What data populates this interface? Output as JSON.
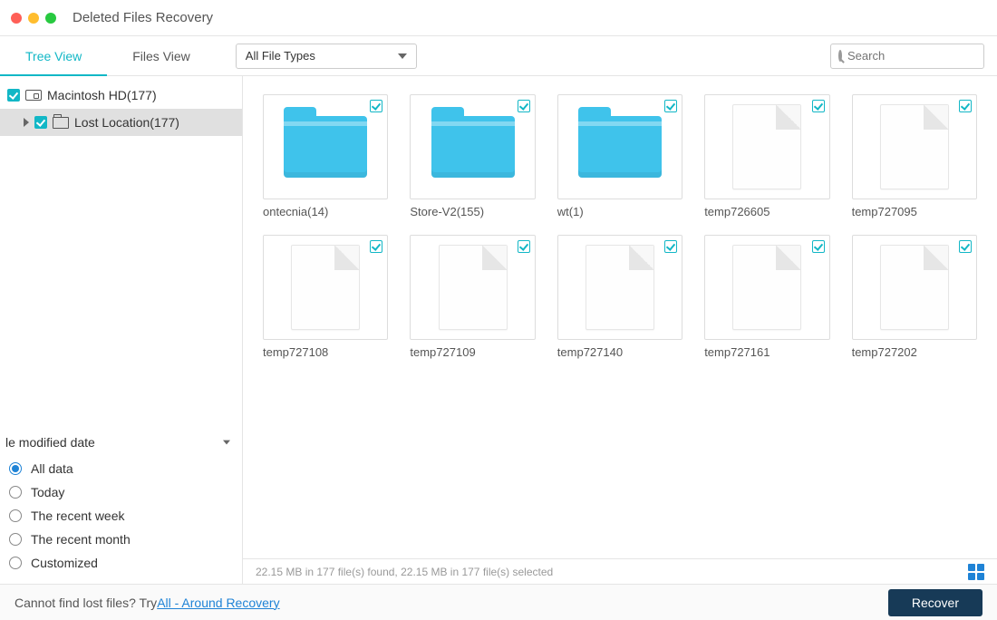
{
  "window": {
    "title": "Deleted Files Recovery"
  },
  "toolbar": {
    "tabs": {
      "tree": "Tree View",
      "files": "Files View"
    },
    "filetype_label": "All File Types",
    "search_placeholder": "Search"
  },
  "tree": {
    "root": "Macintosh HD(177)",
    "child": "Lost Location(177)"
  },
  "filter": {
    "header": "le modified date",
    "options": [
      "All data",
      "Today",
      "The recent week",
      "The recent month",
      "Customized"
    ]
  },
  "items": [
    {
      "name": "ontecnia(14)",
      "type": "folder"
    },
    {
      "name": "Store-V2(155)",
      "type": "folder"
    },
    {
      "name": "wt(1)",
      "type": "folder"
    },
    {
      "name": "temp726605",
      "type": "file"
    },
    {
      "name": "temp727095",
      "type": "file"
    },
    {
      "name": "temp727108",
      "type": "file"
    },
    {
      "name": "temp727109",
      "type": "file"
    },
    {
      "name": "temp727140",
      "type": "file"
    },
    {
      "name": "temp727161",
      "type": "file"
    },
    {
      "name": "temp727202",
      "type": "file"
    }
  ],
  "status": "22.15 MB in 177 file(s) found, 22.15 MB in 177 file(s) selected",
  "footer": {
    "prompt": "Cannot find lost files? Try ",
    "link": "All - Around Recovery",
    "recover": "Recover"
  }
}
